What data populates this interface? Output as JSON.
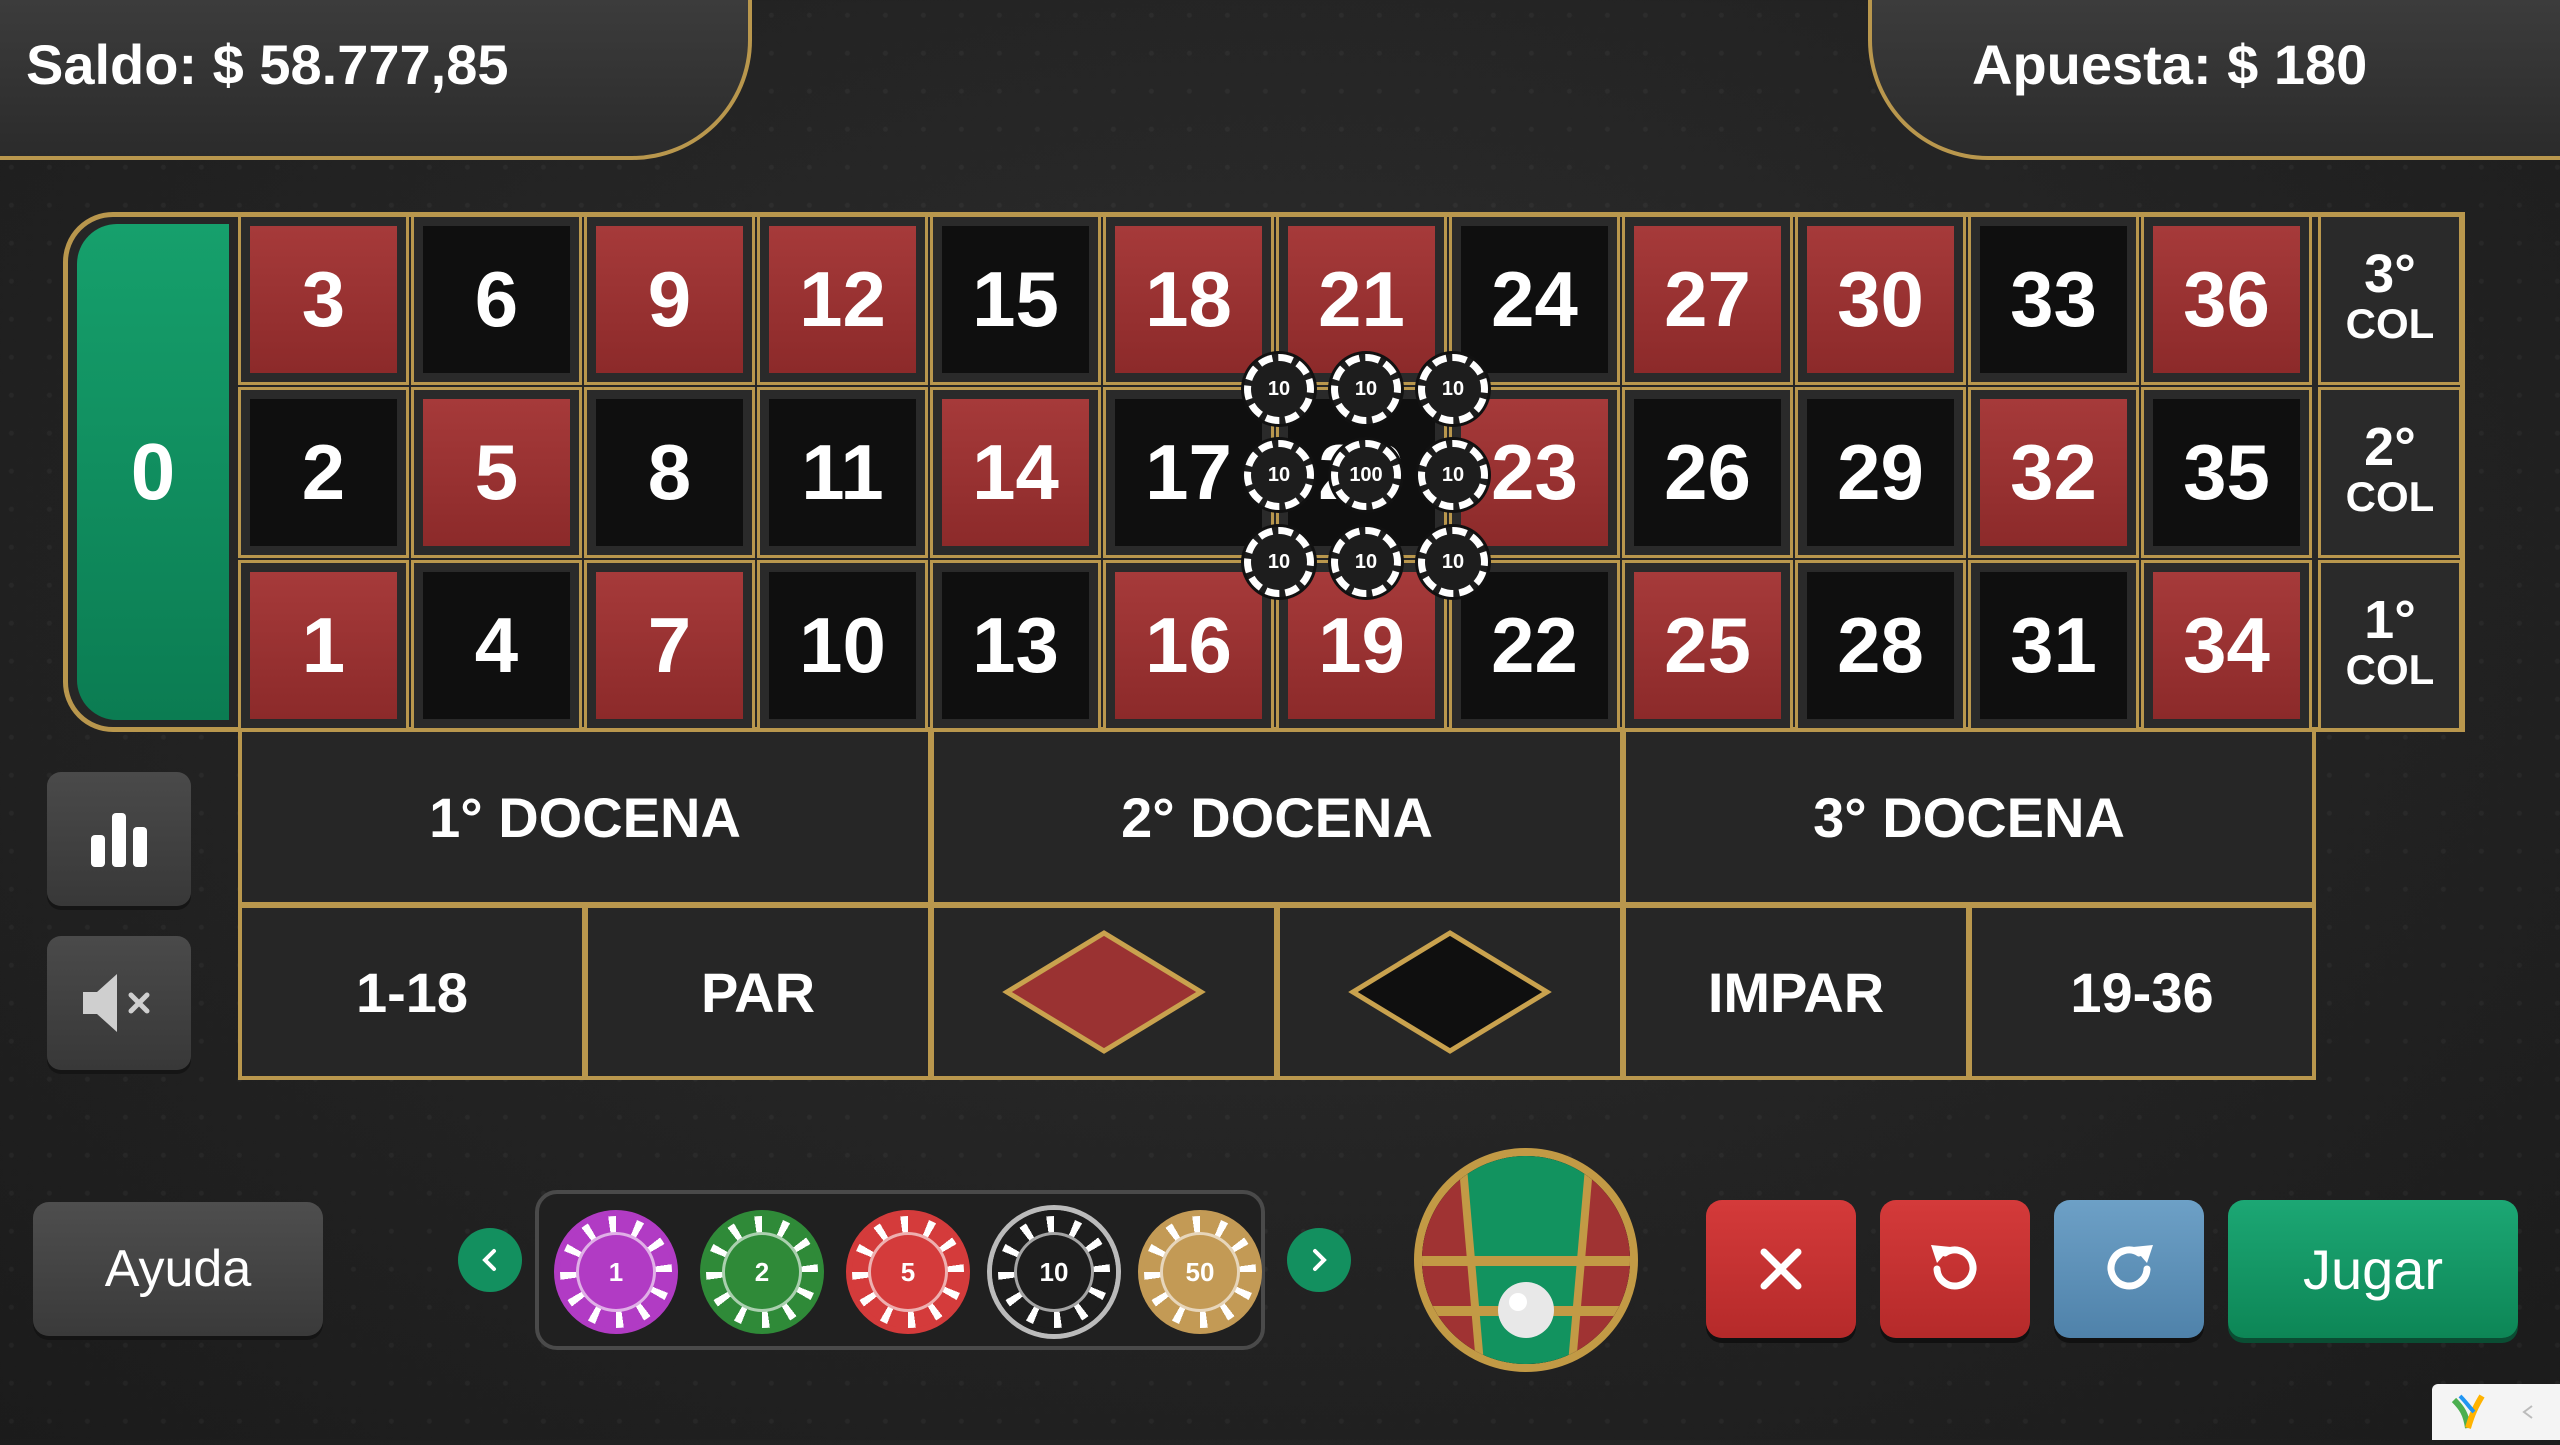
{
  "header": {
    "balance_text": "Saldo: $ 58.777,85",
    "bet_text": "Apuesta: $ 180"
  },
  "board": {
    "zero": "0",
    "rows": [
      [
        {
          "n": "3",
          "c": "red"
        },
        {
          "n": "6",
          "c": "black"
        },
        {
          "n": "9",
          "c": "red"
        },
        {
          "n": "12",
          "c": "red"
        },
        {
          "n": "15",
          "c": "black"
        },
        {
          "n": "18",
          "c": "red"
        },
        {
          "n": "21",
          "c": "red"
        },
        {
          "n": "24",
          "c": "black"
        },
        {
          "n": "27",
          "c": "red"
        },
        {
          "n": "30",
          "c": "red"
        },
        {
          "n": "33",
          "c": "black"
        },
        {
          "n": "36",
          "c": "red"
        }
      ],
      [
        {
          "n": "2",
          "c": "black"
        },
        {
          "n": "5",
          "c": "red"
        },
        {
          "n": "8",
          "c": "black"
        },
        {
          "n": "11",
          "c": "black"
        },
        {
          "n": "14",
          "c": "red"
        },
        {
          "n": "17",
          "c": "black"
        },
        {
          "n": "20",
          "c": "black"
        },
        {
          "n": "23",
          "c": "red"
        },
        {
          "n": "26",
          "c": "black"
        },
        {
          "n": "29",
          "c": "black"
        },
        {
          "n": "32",
          "c": "red"
        },
        {
          "n": "35",
          "c": "black"
        }
      ],
      [
        {
          "n": "1",
          "c": "red"
        },
        {
          "n": "4",
          "c": "black"
        },
        {
          "n": "7",
          "c": "red"
        },
        {
          "n": "10",
          "c": "black"
        },
        {
          "n": "13",
          "c": "black"
        },
        {
          "n": "16",
          "c": "red"
        },
        {
          "n": "19",
          "c": "red"
        },
        {
          "n": "22",
          "c": "black"
        },
        {
          "n": "25",
          "c": "red"
        },
        {
          "n": "28",
          "c": "black"
        },
        {
          "n": "31",
          "c": "black"
        },
        {
          "n": "34",
          "c": "red"
        }
      ]
    ],
    "columns": [
      {
        "top": "3°",
        "bottom": "COL"
      },
      {
        "top": "2°",
        "bottom": "COL"
      },
      {
        "top": "1°",
        "bottom": "COL"
      }
    ],
    "dozens": [
      "1° DOCENA",
      "2° DOCENA",
      "3° DOCENA"
    ],
    "outside": [
      "1-18",
      "PAR",
      "",
      "",
      "IMPAR",
      "19-36"
    ],
    "placed_chips": [
      "10",
      "10",
      "10",
      "10",
      "100",
      "10",
      "10",
      "10",
      "10"
    ]
  },
  "side_buttons": {
    "stats_icon": "bar-chart-icon",
    "mute_icon": "speaker-muted-icon"
  },
  "controls": {
    "help_label": "Ayuda",
    "chips": [
      {
        "value": "1",
        "color": "#b13bc4"
      },
      {
        "value": "2",
        "color": "#2f8a38"
      },
      {
        "value": "5",
        "color": "#d43b3b"
      },
      {
        "value": "10",
        "color": "#1d1d1d"
      },
      {
        "value": "50",
        "color": "#c39a55"
      }
    ],
    "play_label": "Jugar"
  },
  "colors": {
    "gold": "#b9974d",
    "red": "#9a3232",
    "green": "#12935f",
    "clear_button": "#c73434",
    "undo_button": "#c73434",
    "redo_button": "#5b8db5"
  }
}
